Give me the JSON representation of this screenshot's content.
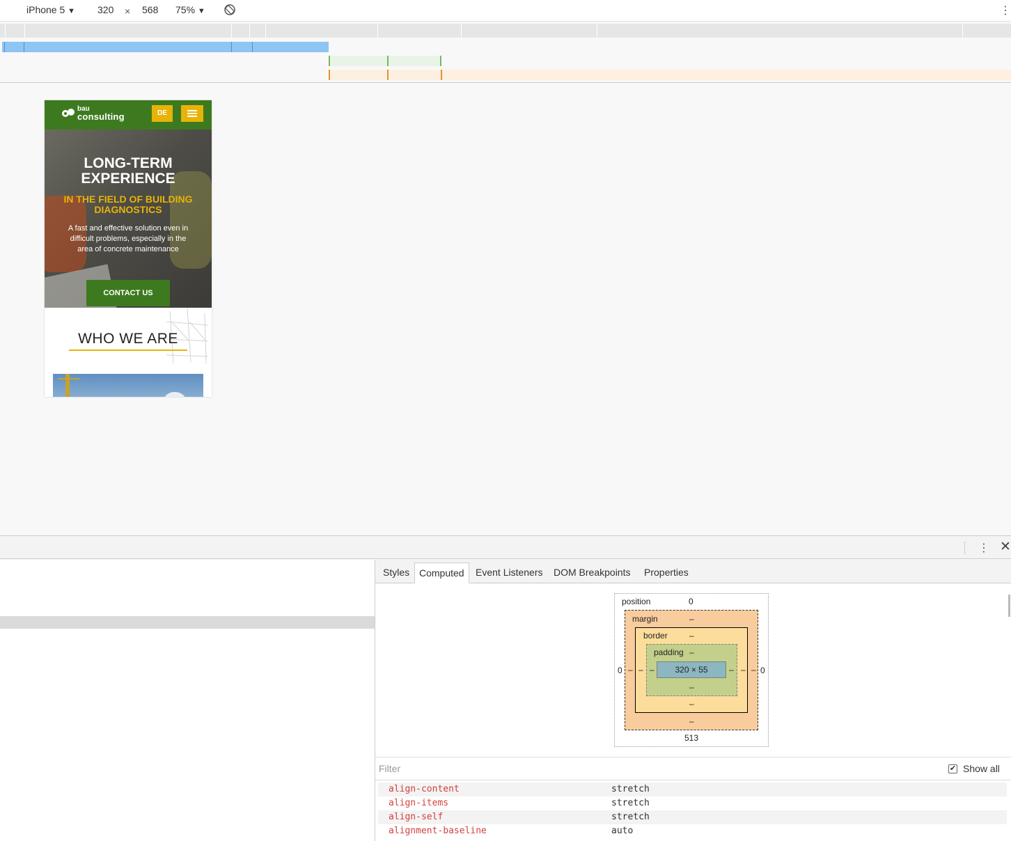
{
  "device_toolbar": {
    "device": "iPhone 5",
    "width": "320",
    "times": "×",
    "height": "568",
    "zoom": "75%",
    "caret": "▼",
    "rotate_icon": "rotate-icon",
    "more_icon": "⋮"
  },
  "site": {
    "logo_line1": "bau",
    "logo_line2": "consulting",
    "lang_button": "DE",
    "hero_title": "LONG-TERM EXPERIENCE",
    "hero_subtitle": "IN THE FIELD OF BUILDING DIAGNOSTICS",
    "hero_desc": "A fast and effective solution even in difficult problems, especially in the area of concrete maintenance",
    "contact_button": "CONTACT US",
    "who_title": "WHO WE ARE",
    "colors": {
      "brand_green": "#3d7a1f",
      "brand_yellow": "#e8b308"
    }
  },
  "drawer": {
    "more_icon": "⋮",
    "close_icon": "✕"
  },
  "tabs": [
    "Styles",
    "Computed",
    "Event Listeners",
    "DOM Breakpoints",
    "Properties"
  ],
  "active_tab": "Computed",
  "box_model": {
    "position_label": "position",
    "position_top": "0",
    "position_left": "0",
    "position_right": "0",
    "position_bottom": "513",
    "margin_label": "margin",
    "margin_top": "–",
    "margin_left": "–",
    "margin_right": "–",
    "margin_bottom": "–",
    "border_label": "border",
    "border_top": "–",
    "border_left": "–",
    "border_right": "–",
    "border_bottom": "–",
    "padding_label": "padding",
    "padding_top": "–",
    "padding_left": "–",
    "padding_right": "–",
    "padding_bottom": "–",
    "content": "320 × 55"
  },
  "filter": {
    "placeholder": "Filter",
    "show_all_label": "Show all",
    "show_all_checked": true,
    "check_mark": "✔"
  },
  "computed_props": [
    {
      "name": "align-content",
      "value": "stretch"
    },
    {
      "name": "align-items",
      "value": "stretch"
    },
    {
      "name": "align-self",
      "value": "stretch"
    },
    {
      "name": "alignment-baseline",
      "value": "auto"
    }
  ]
}
